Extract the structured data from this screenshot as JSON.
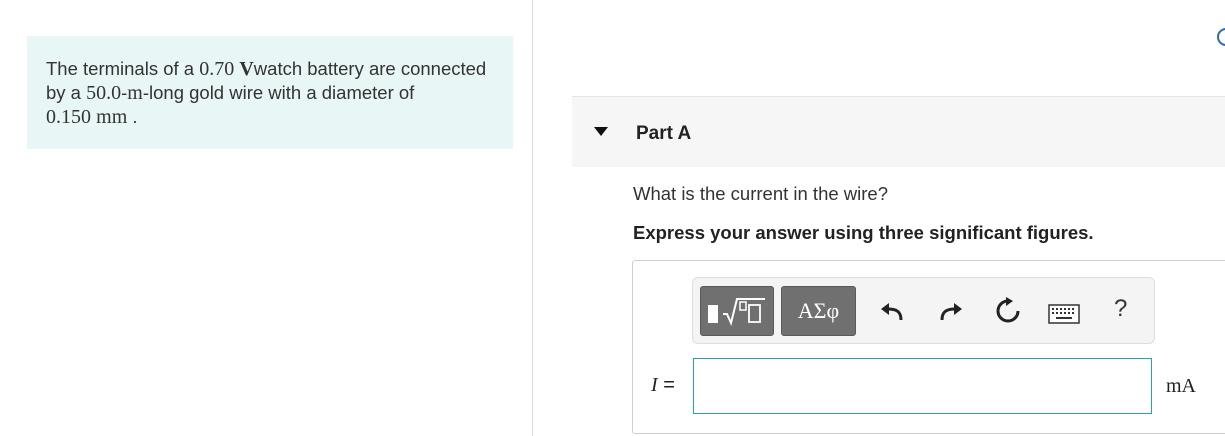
{
  "problem": {
    "text_1": "The terminals of a ",
    "voltage_value": "0.70",
    "voltage_unit": "V",
    "text_2": "watch battery are connected by a ",
    "length_value": "50.0",
    "length_unit": "m",
    "text_3": "-long gold wire with a diameter of ",
    "diameter_value": "0.150",
    "diameter_unit": "mm",
    "text_4": " ."
  },
  "part": {
    "title": "Part A",
    "question": "What is the current in the wire?",
    "instruction": "Express your answer using three significant figures."
  },
  "toolbar": {
    "symbols_label": "ΑΣφ",
    "help_label": "?",
    "icons": [
      "templates-icon",
      "greek-symbols-icon",
      "undo-icon",
      "redo-icon",
      "reset-icon",
      "keyboard-icon",
      "help-icon"
    ]
  },
  "answer": {
    "variable": "I",
    "equals": "=",
    "value": "",
    "unit": "mA"
  },
  "colors": {
    "problem_bg": "#e8f6f6",
    "input_border": "#2a9fb5",
    "toolbar_button": "#707070"
  }
}
